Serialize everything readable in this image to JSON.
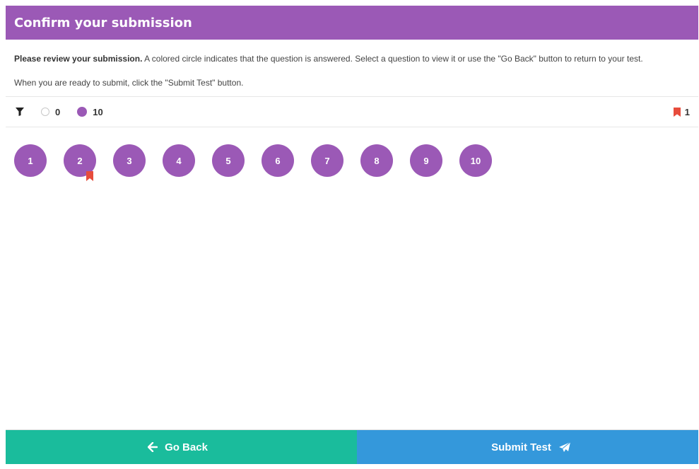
{
  "header": {
    "title": "Confirm your submission"
  },
  "intro": {
    "bold": "Please review your submission.",
    "text": " A colored circle indicates that the question is answered. Select a question to view it or use the \"Go Back\" button to return to your test.",
    "submit_note": "When you are ready to submit, click the \"Submit Test\" button."
  },
  "filterbar": {
    "unanswered_count": "0",
    "answered_count": "10",
    "flagged_count": "1"
  },
  "questions": [
    {
      "label": "1",
      "answered": true,
      "flagged": false
    },
    {
      "label": "2",
      "answered": true,
      "flagged": true
    },
    {
      "label": "3",
      "answered": true,
      "flagged": false
    },
    {
      "label": "4",
      "answered": true,
      "flagged": false
    },
    {
      "label": "5",
      "answered": true,
      "flagged": false
    },
    {
      "label": "6",
      "answered": true,
      "flagged": false
    },
    {
      "label": "7",
      "answered": true,
      "flagged": false
    },
    {
      "label": "8",
      "answered": true,
      "flagged": false
    },
    {
      "label": "9",
      "answered": true,
      "flagged": false
    },
    {
      "label": "10",
      "answered": true,
      "flagged": false
    }
  ],
  "footer": {
    "back_label": "Go Back",
    "submit_label": "Submit Test"
  },
  "colors": {
    "primary": "#9b59b6",
    "back": "#1abc9c",
    "submit": "#3498db",
    "flag": "#e74c3c"
  },
  "icons": {
    "filter": "filter-icon",
    "flag": "bookmark-icon",
    "back": "arrow-left-icon",
    "submit": "paper-plane-icon"
  }
}
